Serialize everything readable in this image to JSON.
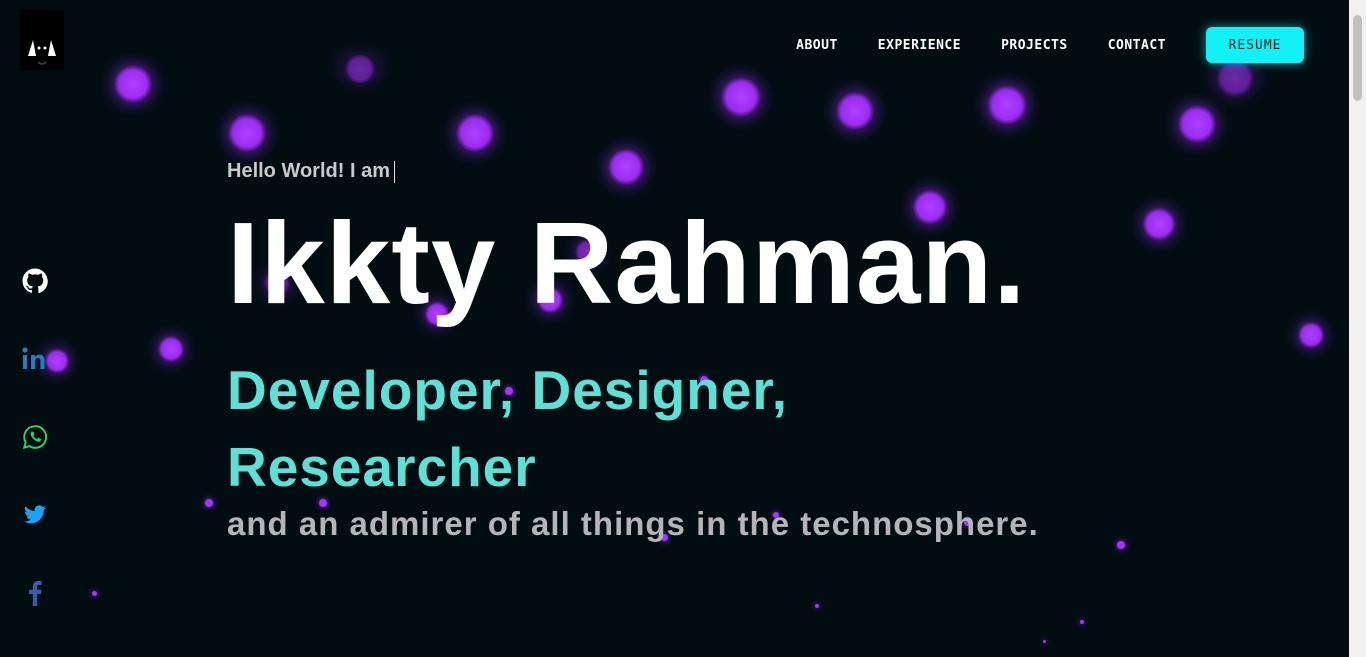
{
  "nav": {
    "about": "ABOUT",
    "experience": "EXPERIENCE",
    "projects": "PROJECTS",
    "contact": "CONTACT",
    "resume": "RESUME"
  },
  "hero": {
    "greeting": "Hello World! I am",
    "name": "Ikkty Rahman.",
    "roles": "Developer, Designer, Researcher",
    "tagline": "and an admirer of all things in the technosphere."
  },
  "socials": [
    "github-icon",
    "linkedin-icon",
    "whatsapp-icon",
    "twitter-icon",
    "facebook-icon"
  ],
  "colors": {
    "background": "#020d11",
    "accent": "#11f1f6",
    "roles": "#5ce1d6",
    "particles": "#9b2cf0"
  }
}
